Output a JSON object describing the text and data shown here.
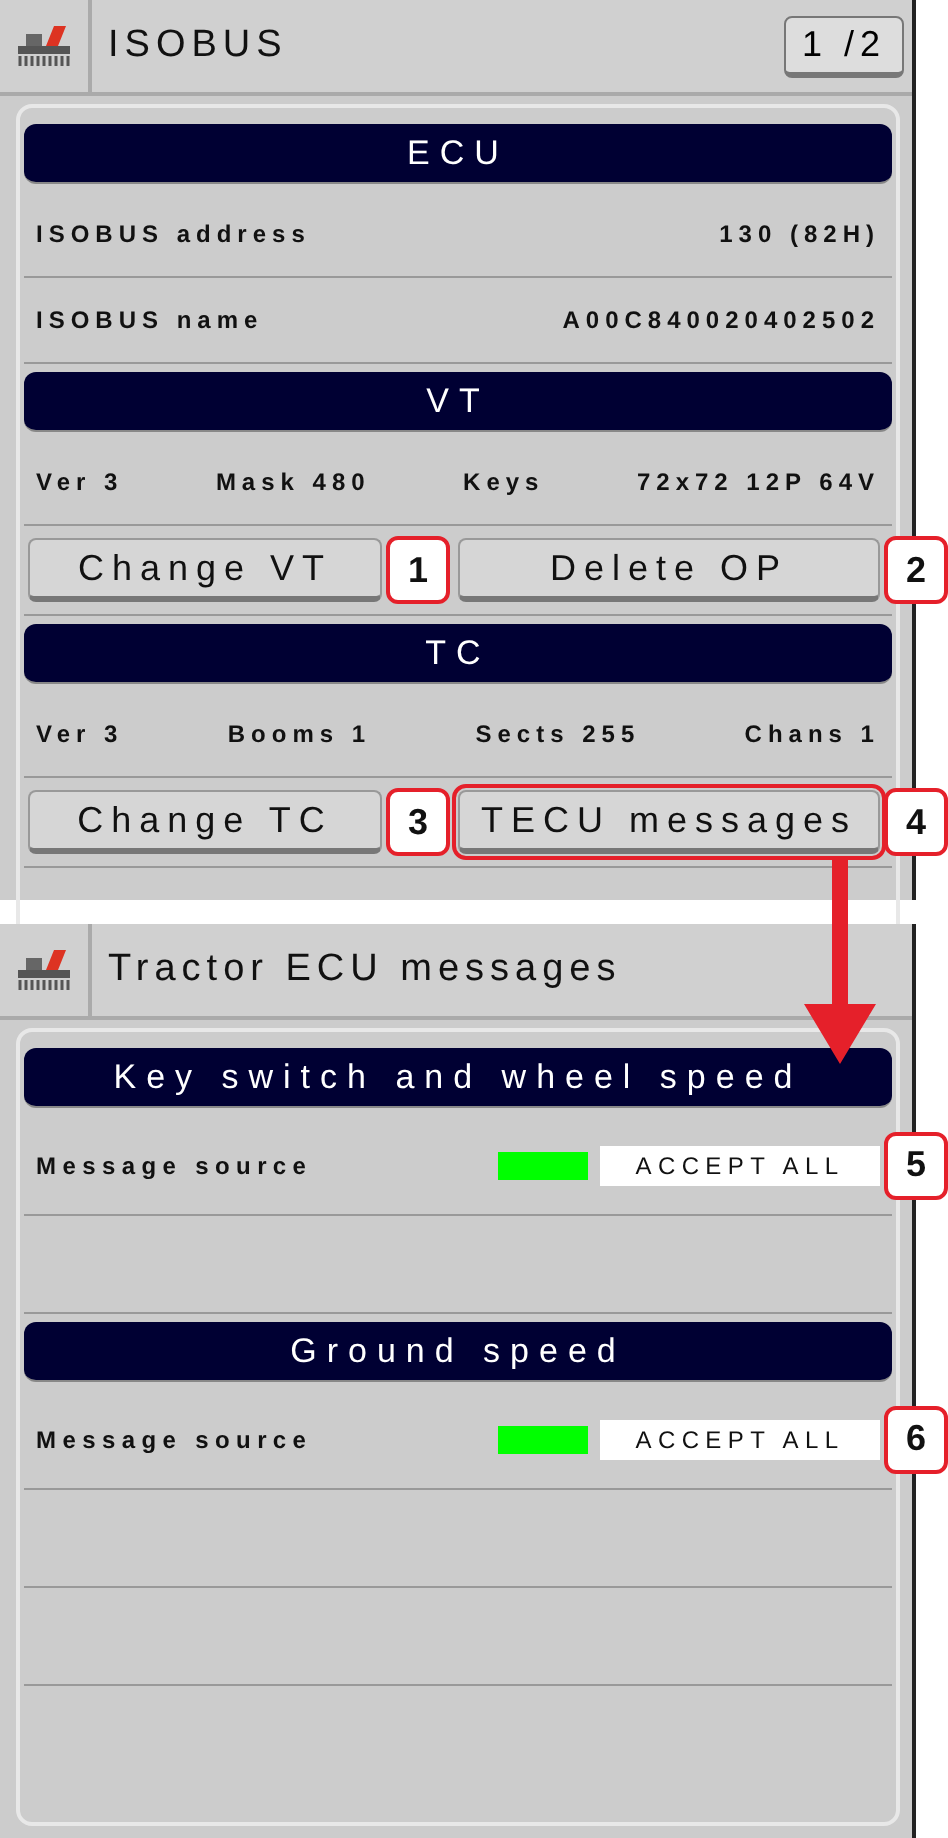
{
  "screens": [
    {
      "title": "ISOBUS",
      "page": "1 /2",
      "sections": [
        {
          "title": "ECU",
          "rows": [
            {
              "kind": "pair",
              "label": "ISOBUS address",
              "value": "130 (82H)"
            },
            {
              "kind": "pair",
              "label": "ISOBUS name",
              "value": "A00C840020402502"
            }
          ]
        },
        {
          "title": "VT",
          "rows": [
            {
              "kind": "specs",
              "items": [
                "Ver 3",
                "Mask 480",
                "Keys",
                "72x72 12P 64V"
              ]
            },
            {
              "kind": "buttons",
              "buttons": [
                {
                  "label": "Change VT",
                  "callout": "1",
                  "outlined": false
                },
                {
                  "label": "Delete OP",
                  "callout": "2",
                  "outlined": false
                }
              ]
            }
          ]
        },
        {
          "title": "TC",
          "rows": [
            {
              "kind": "specs",
              "items": [
                "Ver 3",
                "Booms 1",
                "Sects 255",
                "Chans 1"
              ]
            },
            {
              "kind": "buttons",
              "buttons": [
                {
                  "label": "Change TC",
                  "callout": "3",
                  "outlined": false
                },
                {
                  "label": "TECU messages",
                  "callout": "4",
                  "outlined": true
                }
              ]
            },
            {
              "kind": "blank"
            }
          ]
        }
      ]
    },
    {
      "title": "Tractor ECU messages",
      "sections": [
        {
          "title": "Key switch and wheel speed",
          "rows": [
            {
              "kind": "source",
              "label": "Message source",
              "color": "#00ff00",
              "value": "ACCEPT ALL",
              "callout": "5"
            },
            {
              "kind": "blank"
            }
          ]
        },
        {
          "title": "Ground speed",
          "rows": [
            {
              "kind": "source",
              "label": "Message source",
              "color": "#00ff00",
              "value": "ACCEPT ALL",
              "callout": "6"
            },
            {
              "kind": "blank"
            },
            {
              "kind": "blank"
            },
            {
              "kind": "blank"
            }
          ]
        }
      ]
    }
  ]
}
